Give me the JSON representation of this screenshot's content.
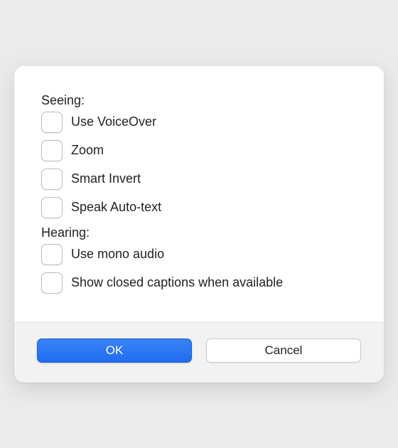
{
  "sections": {
    "seeing": {
      "label": "Seeing:",
      "options": {
        "voiceover": "Use VoiceOver",
        "zoom": "Zoom",
        "smart_invert": "Smart Invert",
        "speak_auto_text": "Speak Auto-text"
      }
    },
    "hearing": {
      "label": "Hearing:",
      "options": {
        "mono_audio": "Use mono audio",
        "closed_captions": "Show closed captions when available"
      }
    }
  },
  "buttons": {
    "ok": "OK",
    "cancel": "Cancel"
  }
}
